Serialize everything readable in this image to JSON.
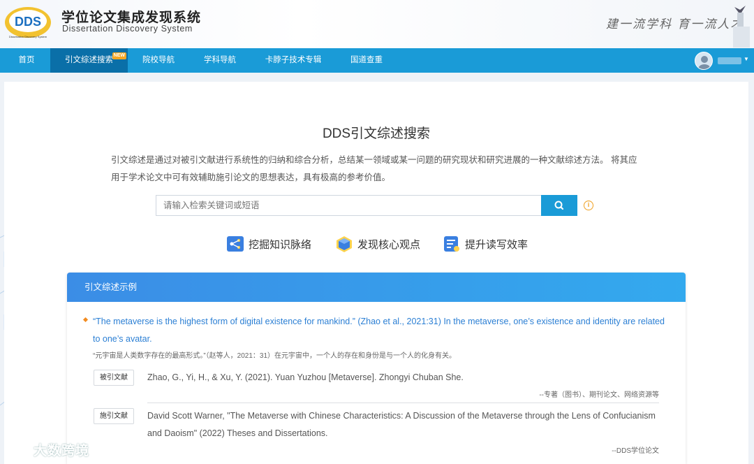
{
  "header": {
    "logo_badge": "DDS",
    "logo_badge_small": "Dissertation Discovery System",
    "title": "学位论文集成发现系统",
    "subtitle": "Dissertation Discovery System",
    "slogan": "建一流学科 育一流人才"
  },
  "nav": {
    "items": [
      {
        "label": "首页"
      },
      {
        "label": "引文综述搜索",
        "badge": "NEW"
      },
      {
        "label": "院校导航"
      },
      {
        "label": "学科导航"
      },
      {
        "label": "卡脖子技术专辑"
      },
      {
        "label": "国道查重"
      }
    ]
  },
  "main": {
    "title": "DDS引文综述搜索",
    "description": "引文综述是通过对被引文献进行系统性的归纳和综合分析，总结某一领域或某一问题的研究现状和研究进展的一种文献综述方法。 将其应用于学术论文中可有效辅助施引论文的思想表达，具有极高的参考价值。",
    "search": {
      "placeholder": "请输入检索关键词或短语"
    },
    "features": [
      {
        "label": "挖掘知识脉络",
        "icon": "network-icon"
      },
      {
        "label": "发现核心观点",
        "icon": "cube-icon"
      },
      {
        "label": "提升读写效率",
        "icon": "document-icon"
      }
    ]
  },
  "example": {
    "heading": "引文综述示例",
    "quote_en": "“The metaverse is the highest form of digital existence for mankind.” (Zhao et al., 2021:31) In the metaverse, one’s existence and identity are related to one’s avatar.",
    "quote_cn": "“元宇宙是人类数字存在的最高形式。”（赵等人，2021：31）在元宇宙中，一个人的存在和身份是与一个人的化身有关。",
    "cited": {
      "tag": "被引文献",
      "text": "Zhao, G., Yi, H., & Xu, Y. (2021). Yuan Yuzhou [Metaverse]. Zhongyi Chuban She.",
      "source": "--专著（图书）、期刊论文、网络资源等"
    },
    "citing": {
      "tag": "施引文献",
      "text": "David Scott Warner, \"The Metaverse with Chinese Characteristics: A Discussion of the Metaverse through the Lens of Confucianism and Daoism\" (2022) Theses and Dissertations.",
      "source": "--DDS学位论文"
    }
  },
  "watermark": "大数跨境",
  "colors": {
    "nav": "#1a9bd7",
    "nav_active": "#0a6fa8",
    "accent_link": "#2b7fd4",
    "panel_head": "#3b8de6"
  }
}
